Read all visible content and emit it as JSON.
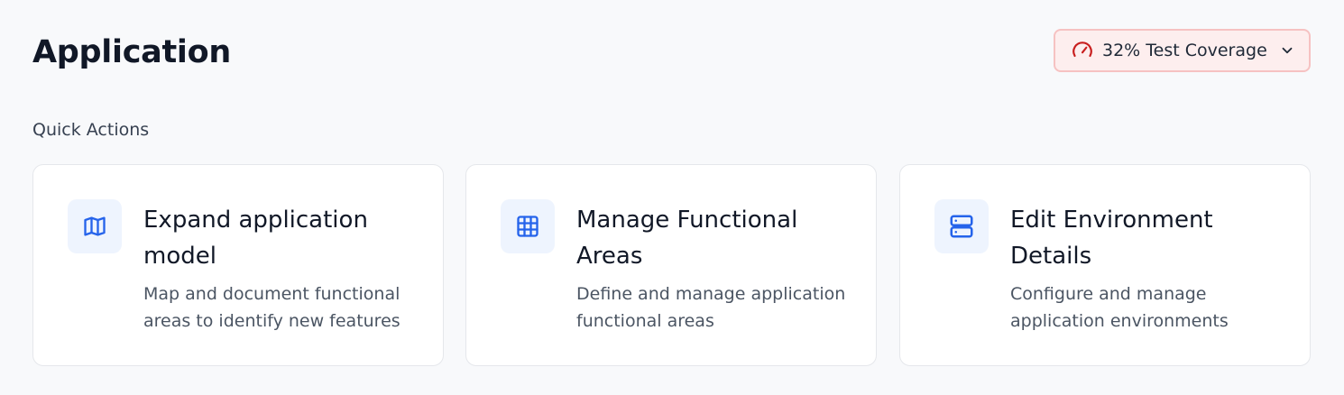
{
  "header": {
    "title": "Application",
    "coverage": {
      "label": "32% Test Coverage",
      "icon": "gauge-icon",
      "accent": "#c81e1e"
    }
  },
  "quick_actions": {
    "section_title": "Quick Actions",
    "cards": [
      {
        "title": "Expand application model",
        "description": "Map and document functional areas to identify new features",
        "icon": "map-icon"
      },
      {
        "title": "Manage Functional Areas",
        "description": "Define and manage application functional areas",
        "icon": "grid-icon"
      },
      {
        "title": "Edit Environment Details",
        "description": "Configure and manage application environments",
        "icon": "server-icon"
      }
    ]
  },
  "colors": {
    "accent_blue": "#2563eb",
    "icon_bg": "#eef4fe",
    "coverage_bg": "#fdeeee",
    "coverage_border": "#f6c2c2"
  }
}
